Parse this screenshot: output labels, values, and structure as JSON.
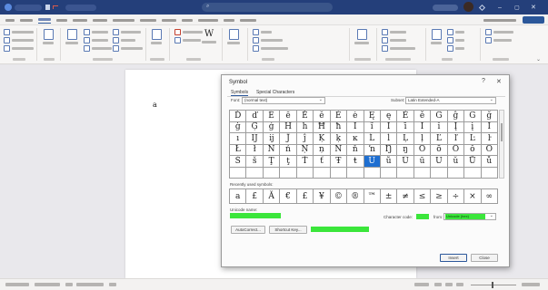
{
  "app": {
    "titlebar": {
      "title": "",
      "search_placeholder": ""
    },
    "menus": [
      "",
      "",
      "",
      "",
      "",
      "",
      "",
      "",
      "",
      "",
      ""
    ],
    "active_menu_index": 3
  },
  "document": {
    "cursor_glyph": "a"
  },
  "symbol_dialog": {
    "title": "Symbol",
    "tabs": [
      "Symbols",
      "Special Characters"
    ],
    "font_label": "Font:",
    "font_value": "(normal text)",
    "subset_label": "Subset:",
    "subset_value": "Latin Extended-A",
    "grid": [
      [
        "Ď",
        "ď",
        "Ē",
        "ē",
        "Ĕ",
        "ĕ",
        "Ė",
        "ė",
        "Ę",
        "ę",
        "Ě",
        "ě",
        "Ĝ",
        "ĝ",
        "Ğ",
        "ğ",
        "Ġ"
      ],
      [
        "ġ",
        "Ģ",
        "ģ",
        "Ĥ",
        "ĥ",
        "Ħ",
        "ħ",
        "Ĩ",
        "ĩ",
        "Ī",
        "ī",
        "Ĭ",
        "ĭ",
        "Į",
        "į",
        "İ"
      ],
      [
        "ı",
        "Ĳ",
        "ĳ",
        "Ĵ",
        "ĵ",
        "Ķ",
        "ķ",
        "ĸ",
        "Ĺ",
        "ĺ",
        "Ļ",
        "ļ",
        "Ľ",
        "ľ",
        "Ŀ",
        "ŀ"
      ],
      [
        "Ł",
        "ł",
        "Ń",
        "ń",
        "Ņ",
        "ņ",
        "Ň",
        "ň",
        "ŉ",
        "Ŋ",
        "ŋ",
        "Ō",
        "ō",
        "Ŏ",
        "ŏ",
        "Ő"
      ],
      [
        "Š",
        "š",
        "Ţ",
        "ţ",
        "Ť",
        "ť",
        "Ŧ",
        "ŧ",
        "Ũ",
        "ũ",
        "Ū",
        "ū",
        "Ŭ",
        "ŭ",
        "Ů",
        "ů"
      ],
      [
        "",
        "",
        "",
        "",
        "",
        "",
        "",
        "",
        "",
        "",
        "",
        "",
        "",
        "",
        "",
        ""
      ]
    ],
    "selected_index": [
      4,
      8
    ],
    "recent_label": "Recently used symbols:",
    "recent": [
      "a",
      "£",
      "Ă",
      "€",
      "£",
      "¥",
      "©",
      "®",
      "™",
      "±",
      "≠",
      "≤",
      "≥",
      "÷",
      "×",
      "∞"
    ],
    "unicode_name_label": "Unicode name:",
    "unicode_name_value": "",
    "char_code_label": "Character code:",
    "char_code_value": "",
    "from_label": "from:",
    "from_value": "Unicode (hex)",
    "autocorrect_button": "AutoCorrect...",
    "shortcut_key_button": "Shortcut Key...",
    "shortcut_key_value": "",
    "insert_button": "Insert",
    "close_button": "Close"
  }
}
